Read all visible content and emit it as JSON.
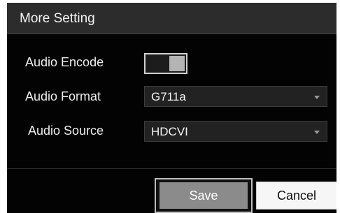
{
  "dialog": {
    "title": "More Setting"
  },
  "fields": {
    "audio_encode": {
      "label": "Audio Encode",
      "enabled": true
    },
    "audio_format": {
      "label": "Audio Format",
      "value": "G711a"
    },
    "audio_source": {
      "label": "Audio Source",
      "value": "HDCVI"
    }
  },
  "buttons": {
    "save_label": "Save",
    "cancel_label": "Cancel"
  },
  "icons": {
    "dropdown": "chevron-down-icon"
  }
}
